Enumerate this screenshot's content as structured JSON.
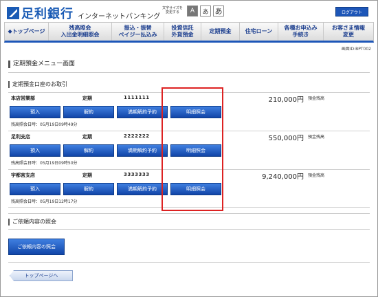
{
  "header": {
    "bank_name": "足利銀行",
    "service_name": "インターネットバンキング",
    "font_size_label_1": "文字サイズを",
    "font_size_label_2": "変更する",
    "font_sizes": [
      "A",
      "あ",
      "あ"
    ],
    "logout_label": "ログアウト"
  },
  "nav": {
    "items": [
      {
        "line1": "◆トップページ",
        "line2": ""
      },
      {
        "line1": "残高照会",
        "line2": "入出金明細照会"
      },
      {
        "line1": "振込・振替",
        "line2": "ペイジー払込み"
      },
      {
        "line1": "投資信託",
        "line2": "外貨預金"
      },
      {
        "line1": "定期預金",
        "line2": ""
      },
      {
        "line1": "住宅ローン",
        "line2": ""
      },
      {
        "line1": "各種お申込み",
        "line2": "手続き"
      },
      {
        "line1": "お客さま情報",
        "line2": "変更"
      }
    ]
  },
  "page_id": "画面ID:BPT002",
  "title": "定期預金メニュー画面",
  "section_accounts": "定期預金口座のお取引",
  "buttons": {
    "deposit": "預入",
    "cancel": "解約",
    "maturity_reservation": "満期解約予約",
    "details": "明細照会"
  },
  "accounts": [
    {
      "branch": "本店営業部",
      "type": "定期",
      "number": "1111111",
      "balance": "210,000円",
      "balance_label": "預金残高",
      "timestamp": "残高照会日時：05月19日09時49分"
    },
    {
      "branch": "足利支店",
      "type": "定期",
      "number": "2222222",
      "balance": "550,000円",
      "balance_label": "預金残高",
      "timestamp": "残高照会日時：05月19日09時50分"
    },
    {
      "branch": "宇都宮支店",
      "type": "定期",
      "number": "3333333",
      "balance": "9,240,000円",
      "balance_label": "預金残高",
      "timestamp": "残高照会日時：05月19日12時17分"
    }
  ],
  "section_inquiry": "ご依頼内容の照会",
  "inquiry_button": "ご依頼内容の照会",
  "top_button": "トップページへ"
}
